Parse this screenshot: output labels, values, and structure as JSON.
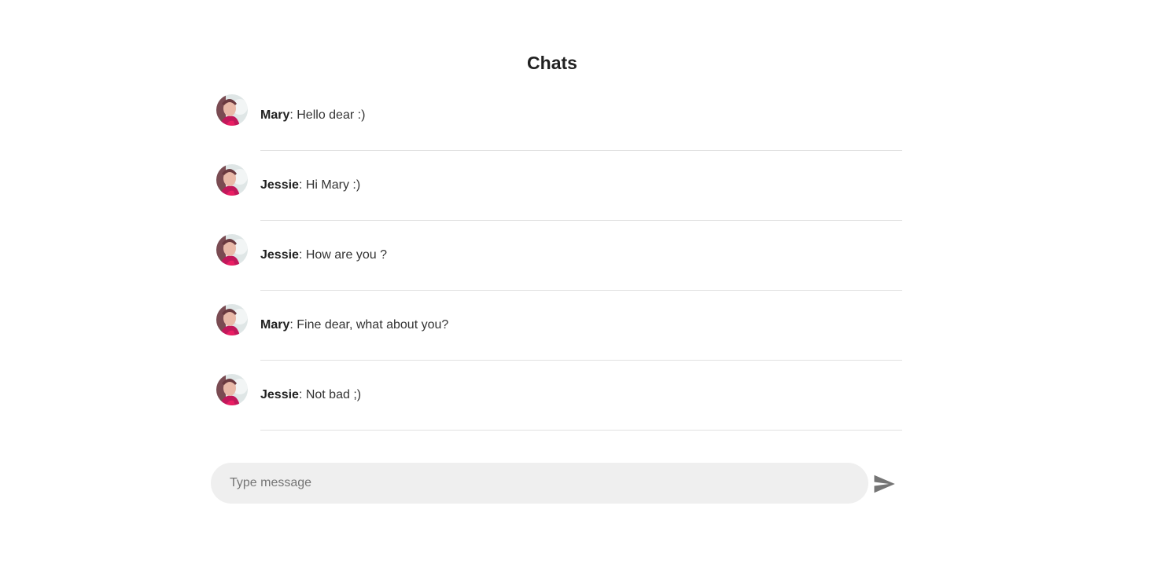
{
  "header": {
    "title": "Chats"
  },
  "messages": [
    {
      "sender": "Mary",
      "text": ": Hello dear :)"
    },
    {
      "sender": "Jessie",
      "text": ": Hi Mary :)"
    },
    {
      "sender": "Jessie",
      "text": ": How are you ?"
    },
    {
      "sender": "Mary",
      "text": ": Fine dear, what about you?"
    },
    {
      "sender": "Jessie",
      "text": ": Not bad ;)"
    }
  ],
  "composer": {
    "placeholder": "Type message",
    "value": "",
    "send_icon": "send-icon"
  },
  "colors": {
    "input_background": "#efefef",
    "divider": "#e0e0e0",
    "send_icon": "#757575",
    "text": "#212121"
  }
}
